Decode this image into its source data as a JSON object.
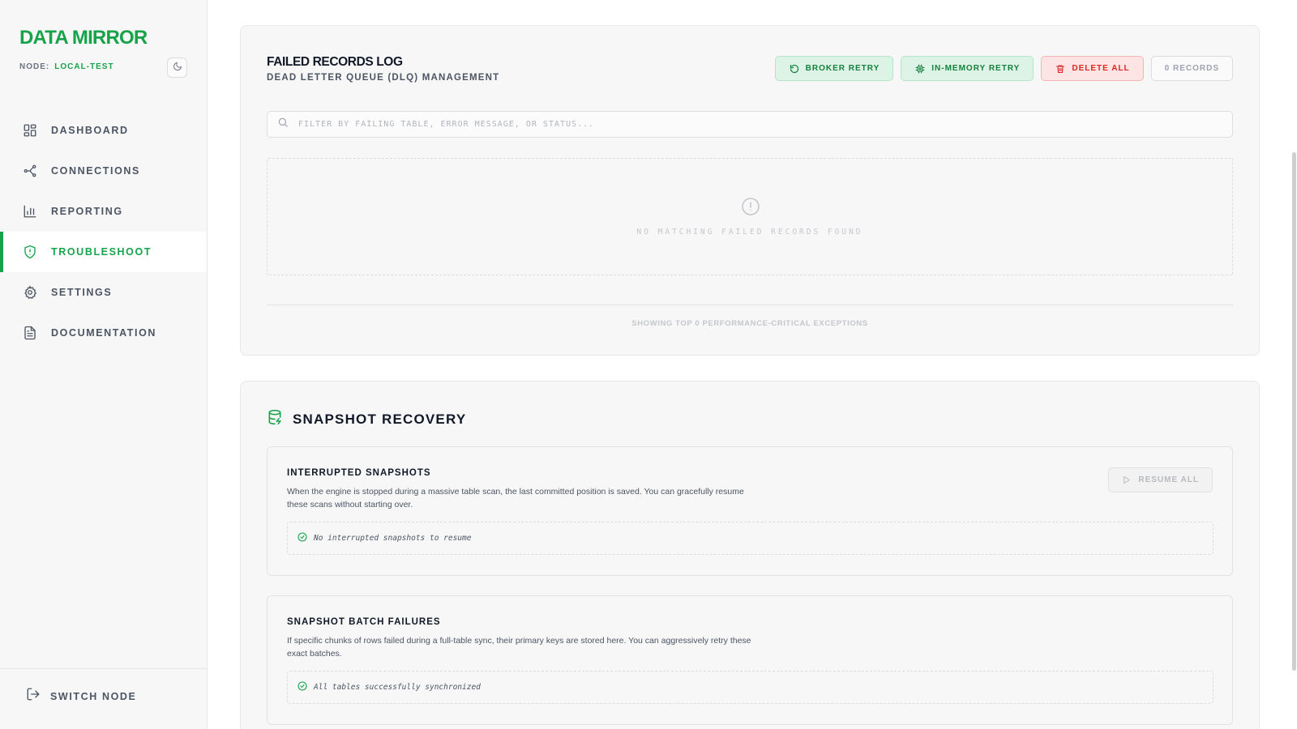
{
  "sidebar": {
    "brand": "DATA MIRROR",
    "node_label": "NODE:",
    "node_value": "LOCAL-TEST",
    "items": [
      {
        "label": "DASHBOARD",
        "icon": "dashboard-icon"
      },
      {
        "label": "CONNECTIONS",
        "icon": "connections-icon"
      },
      {
        "label": "REPORTING",
        "icon": "bar-chart-icon"
      },
      {
        "label": "TROUBLESHOOT",
        "icon": "shield-alert-icon",
        "active": true
      },
      {
        "label": "SETTINGS",
        "icon": "gear-icon"
      },
      {
        "label": "DOCUMENTATION",
        "icon": "document-icon"
      }
    ],
    "switch_node": "SWITCH NODE"
  },
  "dlq": {
    "title": "FAILED RECORDS LOG",
    "subtitle": "DEAD LETTER QUEUE (DLQ) MANAGEMENT",
    "actions": {
      "broker_retry": "BROKER RETRY",
      "memory_retry": "IN-MEMORY RETRY",
      "delete_all": "DELETE ALL",
      "record_count": "0 RECORDS"
    },
    "filter_placeholder": "FILTER BY FAILING TABLE, ERROR MESSAGE, OR STATUS...",
    "empty_message": "NO MATCHING FAILED RECORDS FOUND",
    "footer": "SHOWING TOP 0 PERFORMANCE-CRITICAL EXCEPTIONS"
  },
  "snapshot": {
    "title": "SNAPSHOT RECOVERY",
    "interrupted": {
      "title": "INTERRUPTED SNAPSHOTS",
      "description": "When the engine is stopped during a massive table scan, the last committed position is saved. You can gracefully resume these scans without starting over.",
      "resume_label": "RESUME ALL",
      "status": "No interrupted snapshots to resume"
    },
    "batch": {
      "title": "SNAPSHOT BATCH FAILURES",
      "description": "If specific chunks of rows failed during a full-table sync, their primary keys are stored here. You can aggressively retry these exact batches.",
      "status": "All tables successfully synchronized"
    }
  },
  "colors": {
    "accent": "#16a34a",
    "danger": "#dc2626",
    "surface": "#f7f7f7"
  }
}
